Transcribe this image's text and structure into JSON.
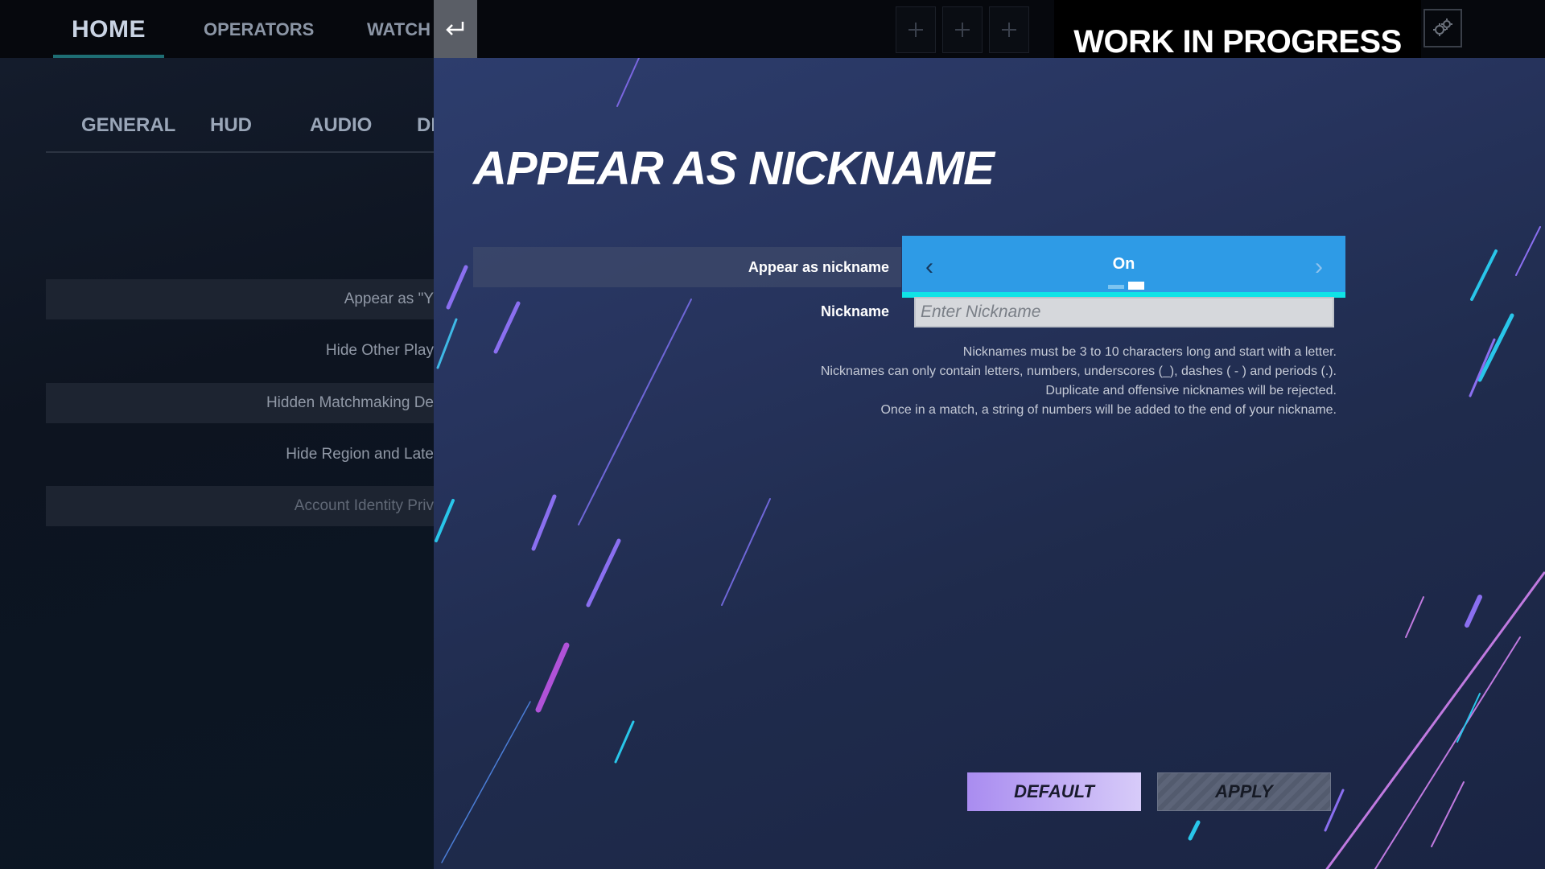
{
  "topbar": {
    "tabs": [
      {
        "label": "HOME",
        "active": true
      },
      {
        "label": "OPERATORS",
        "active": false
      },
      {
        "label": "WATCH",
        "active": false
      }
    ],
    "back_icon": "return-arrow-icon",
    "settings_icon": "gear-icon",
    "plus_icon": "plus-icon",
    "wip_label": "WORK IN PROGRESS"
  },
  "background_page": {
    "subtabs": [
      "GENERAL",
      "HUD",
      "AUDIO",
      "DI"
    ],
    "rows": [
      "Appear as \"Y",
      "Hide Other Play",
      "Hidden Matchmaking De",
      "Hide Region and Late",
      "Account Identity Priv"
    ]
  },
  "modal": {
    "title": "APPEAR AS NICKNAME",
    "appear_setting": {
      "label": "Appear as nickname",
      "value": "On",
      "prev_icon": "chevron-left-icon",
      "next_icon": "chevron-right-icon"
    },
    "nickname": {
      "label": "Nickname",
      "value": "",
      "placeholder": "Enter Nickname"
    },
    "rules": [
      "Nicknames must be 3 to 10 characters long and start with a letter.",
      "Nicknames can only contain letters, numbers, underscores (_), dashes ( - ) and periods (.).",
      "Duplicate and offensive nicknames will be rejected.",
      "Once in a match, a string of numbers will be added to the end of your nickname."
    ],
    "buttons": {
      "default_label": "DEFAULT",
      "apply_label": "APPLY"
    }
  },
  "colors": {
    "selector_blue": "#2e9be6",
    "selector_cyan": "#10e3e6",
    "default_button": "#a98cf0",
    "panel_bg": "#27345e"
  }
}
